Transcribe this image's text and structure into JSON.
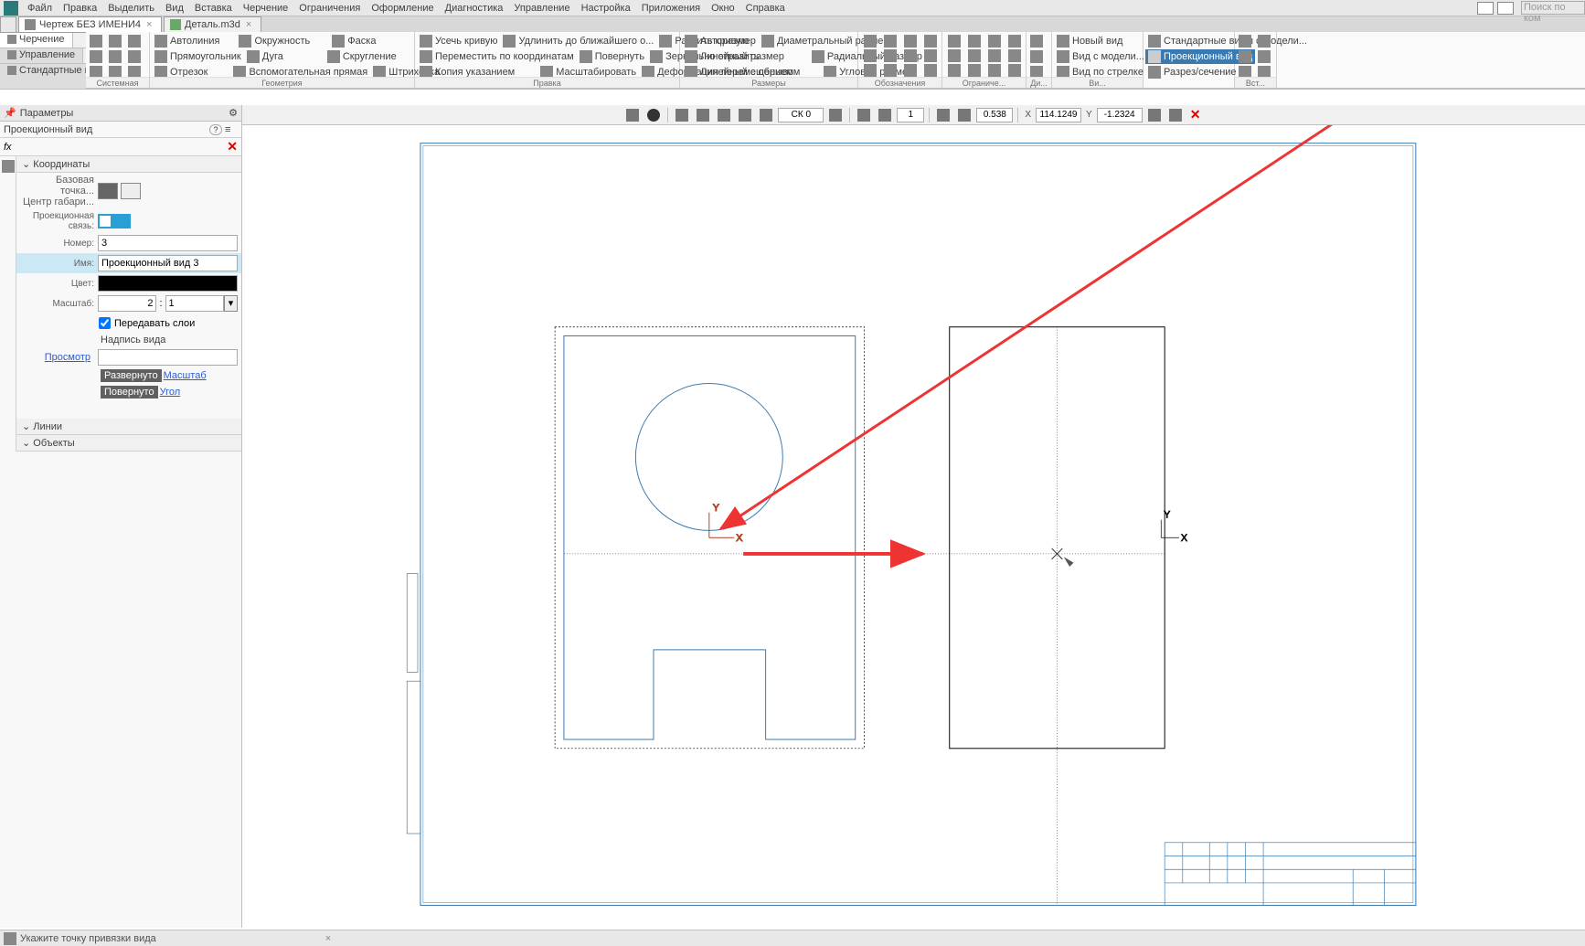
{
  "menubar": [
    "Файл",
    "Правка",
    "Выделить",
    "Вид",
    "Вставка",
    "Черчение",
    "Ограничения",
    "Оформление",
    "Диагностика",
    "Управление",
    "Настройка",
    "Приложения",
    "Окно",
    "Справка"
  ],
  "search_placeholder": "Поиск по ком",
  "tabs": [
    {
      "label": "Чертеж БЕЗ ИМЕНИ4",
      "active": true
    },
    {
      "label": "Деталь.m3d",
      "active": false
    }
  ],
  "modes": [
    {
      "label": "Черчение",
      "active": true
    },
    {
      "label": "Управление",
      "active": false
    },
    {
      "label": "Стандартные изделия",
      "active": false
    }
  ],
  "ribbon": {
    "sys_label": "Системная",
    "geom": {
      "label": "Геометрия",
      "avtolinia": "Автолиния",
      "okr": "Окружность",
      "faska": "Фаска",
      "pryam": "Прямоугольник",
      "duga": "Дуга",
      "skrug": "Скругление",
      "otrezok": "Отрезок",
      "vspom": "Вспомогательная прямая",
      "shtrih": "Штриховка"
    },
    "pravka": {
      "label": "Правка",
      "usech": "Усечь кривую",
      "peremest": "Переместить по координатам",
      "kopii": "Копия указанием",
      "udlin": "Удлинить до ближайшего о...",
      "povernut": "Повернуть",
      "masshtab": "Масштабировать",
      "razbit": "Разбить кривую",
      "zerkalo": "Зеркально отразить",
      "deform": "Деформация перемещением"
    },
    "razmery": {
      "label": "Размеры",
      "avto": "Авторазмер",
      "linein": "Линейный размер",
      "lineino": "Линейный с обрывом",
      "diam": "Диаметральный размер",
      "radial": "Радиальный размер",
      "uglov": "Угловой размер"
    },
    "oboz_label": "Обозначения",
    "ogr_label": "Ограниче...",
    "dia_label": "Ди...",
    "vidy": {
      "label": "Ви...",
      "noviy": "Новый вид",
      "smodel": "Вид с модели...",
      "postrelke": "Вид по стрелке",
      "std": "Стандартные виды с модели...",
      "proek": "Проекционный вид",
      "razrez": "Разрез/сечение"
    },
    "vst_label": "Вст..."
  },
  "panel": {
    "header": "Параметры",
    "title": "Проекционный вид",
    "sec_coord": "Координаты",
    "bazovaya": "Базовая точка...",
    "centr": "Центр габари...",
    "proek_svyaz": "Проекционная связь:",
    "nomer_lbl": "Номер:",
    "nomer_val": "3",
    "imya_lbl": "Имя:",
    "imya_val": "Проекционный вид 3",
    "cvet_lbl": "Цвет:",
    "mass_lbl": "Масштаб:",
    "mass_a": "2",
    "mass_b": "1",
    "peredsloi": "Передавать слои",
    "nadpis": "Надпись вида",
    "prosmotr": "Просмотр",
    "razvernuto": "Развернуто",
    "masshtab": "Масштаб",
    "povernuto": "Повернуто",
    "ugol": "Угол",
    "sec_linii": "Линии",
    "sec_obj": "Объекты"
  },
  "cvtoolbar": {
    "ck": "СК 0",
    "scale_in": "1",
    "zoom": "0.538",
    "x_lbl": "X",
    "x_val": "114.1249",
    "y_lbl": "Y",
    "y_val": "-1.2324"
  },
  "statusbar": "Укажите точку привязки вида"
}
